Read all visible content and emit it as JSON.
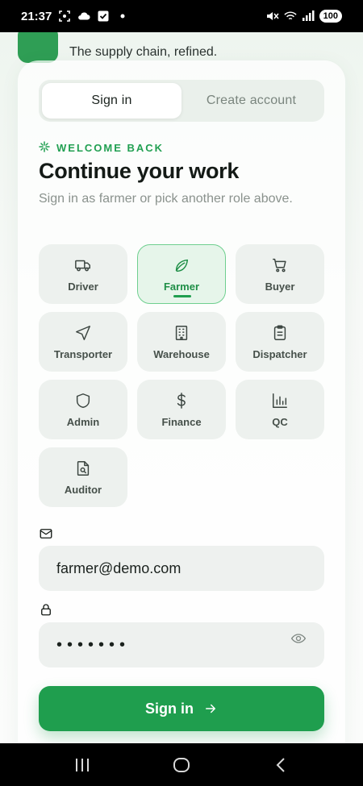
{
  "status_bar": {
    "time": "21:37",
    "battery": "100"
  },
  "brand": {
    "tagline": "The supply chain, refined."
  },
  "tabs": {
    "signin": "Sign in",
    "create": "Create account"
  },
  "intro": {
    "eyebrow": "WELCOME BACK",
    "heading": "Continue your work",
    "subtext": "Sign in as farmer or pick another role above."
  },
  "roles": [
    {
      "label": "Driver",
      "icon": "truck-icon"
    },
    {
      "label": "Farmer",
      "icon": "leaf-icon",
      "selected": true
    },
    {
      "label": "Buyer",
      "icon": "cart-icon"
    },
    {
      "label": "Transporter",
      "icon": "navigation-icon"
    },
    {
      "label": "Warehouse",
      "icon": "building-icon"
    },
    {
      "label": "Dispatcher",
      "icon": "clipboard-icon"
    },
    {
      "label": "Admin",
      "icon": "shield-icon"
    },
    {
      "label": "Finance",
      "icon": "dollar-icon"
    },
    {
      "label": "QC",
      "icon": "bar-chart-icon"
    },
    {
      "label": "Auditor",
      "icon": "file-search-icon"
    }
  ],
  "form": {
    "email_value": "farmer@demo.com",
    "password_value": "•••••••",
    "submit_label": "Sign in"
  },
  "colors": {
    "accent": "#1f9e4e",
    "accent_light": "#e6f5ea",
    "muted": "#8a928d"
  }
}
